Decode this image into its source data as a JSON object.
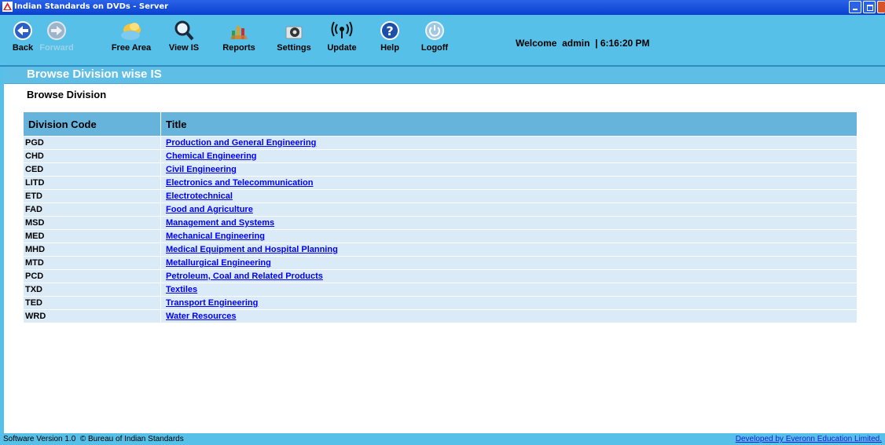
{
  "window": {
    "title": "Indian Standards on DVDs - Server"
  },
  "toolbar": {
    "buttons": [
      {
        "label": "Back",
        "icon": "back-arrow-icon"
      },
      {
        "label": "Forward",
        "icon": "forward-arrow-icon",
        "disabled": true
      },
      {
        "label": "Free Area",
        "icon": "free-area-icon"
      },
      {
        "label": "View IS",
        "icon": "magnifier-icon"
      },
      {
        "label": "Reports",
        "icon": "reports-chart-icon"
      },
      {
        "label": "Settings",
        "icon": "settings-gear-icon"
      },
      {
        "label": "Update",
        "icon": "update-signal-icon"
      },
      {
        "label": "Help",
        "icon": "help-icon"
      },
      {
        "label": "Logoff",
        "icon": "power-icon"
      }
    ],
    "welcome": "Welcome  admin  | 6:16:20 PM"
  },
  "page": {
    "title": "Browse Division wise IS",
    "subheading": "Browse Division"
  },
  "table": {
    "headers": [
      "Division Code",
      "Title"
    ],
    "rows": [
      {
        "code": "PGD",
        "title": "Production and General Engineering"
      },
      {
        "code": "CHD",
        "title": "Chemical Engineering"
      },
      {
        "code": "CED",
        "title": "Civil Engineering"
      },
      {
        "code": "LITD",
        "title": "Electronics and Telecommunication"
      },
      {
        "code": "ETD",
        "title": "Electrotechnical"
      },
      {
        "code": "FAD",
        "title": "Food and Agriculture"
      },
      {
        "code": "MSD",
        "title": "Management and Systems"
      },
      {
        "code": "MED",
        "title": "Mechanical Engineering"
      },
      {
        "code": "MHD",
        "title": "Medical Equipment and Hospital Planning"
      },
      {
        "code": "MTD",
        "title": "Metallurgical Engineering"
      },
      {
        "code": "PCD",
        "title": "Petroleum, Coal and Related Products"
      },
      {
        "code": "TXD",
        "title": "Textiles"
      },
      {
        "code": "TED",
        "title": "Transport Engineering"
      },
      {
        "code": "WRD",
        "title": "Water Resources"
      }
    ]
  },
  "status": {
    "version": "Software Version 1.0  © Bureau of Indian Standards",
    "developer": "Developed by Everonn Education Limited."
  },
  "colors": {
    "toolbar": "#56c0e8",
    "header_row": "#66b4dc",
    "row": "#dbeaf7",
    "link": "#0000ff"
  }
}
